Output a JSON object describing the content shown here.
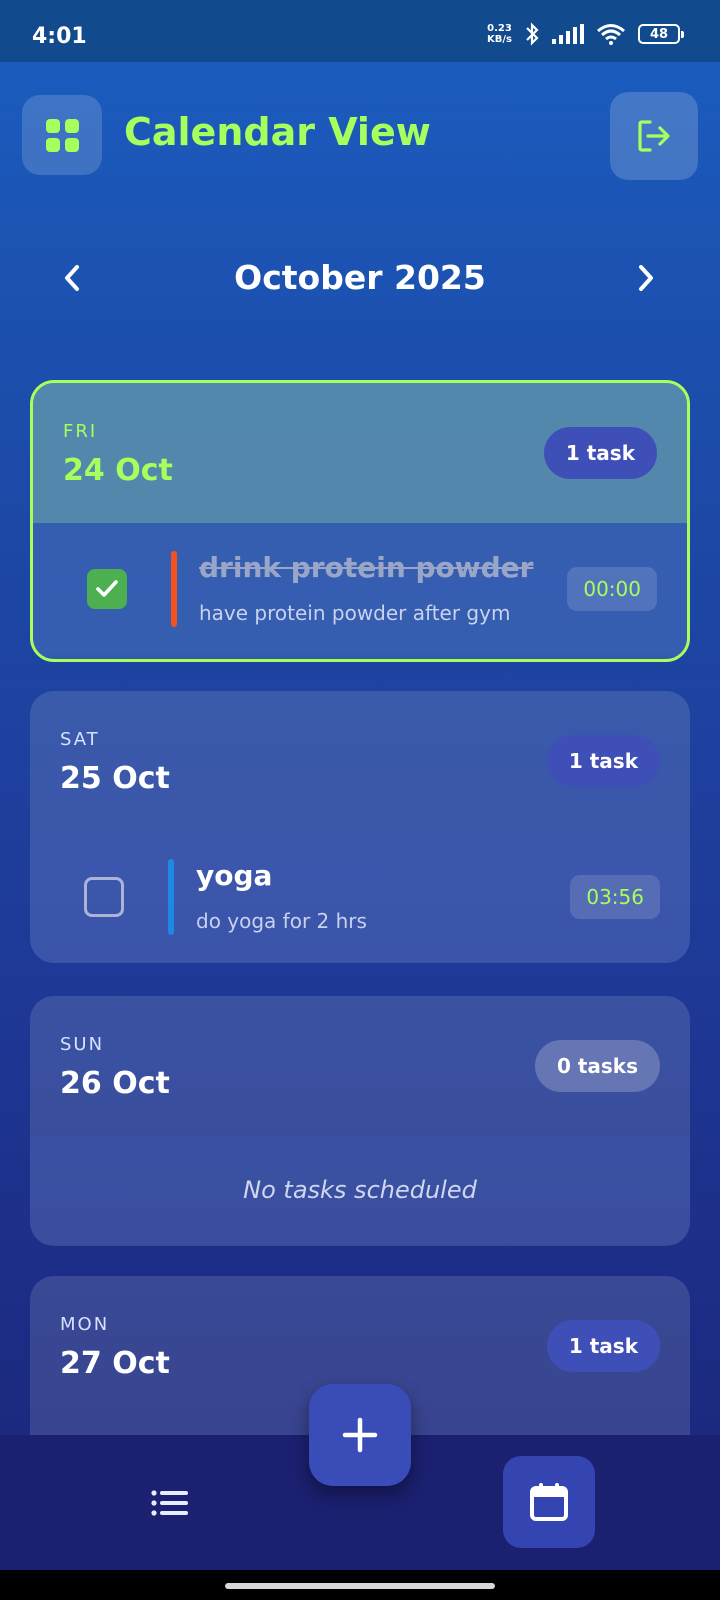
{
  "status_bar": {
    "time": "4:01",
    "net_speed_value": "0.23",
    "net_speed_unit": "KB/s",
    "battery": "48"
  },
  "header": {
    "title": "Calendar View",
    "menu_icon": "grid-icon",
    "logout_icon": "logout-icon"
  },
  "month_nav": {
    "title": "October 2025",
    "prev_icon": "chevron-left-icon",
    "next_icon": "chevron-right-icon"
  },
  "days": [
    {
      "weekday": "FRI",
      "date": "24 Oct",
      "badge": "1 task",
      "selected": true,
      "tasks": [
        {
          "title": "drink protein powder",
          "description": "have protein powder after gym",
          "time": "00:00",
          "done": true,
          "priority_color": "#f4511e"
        }
      ]
    },
    {
      "weekday": "SAT",
      "date": "25 Oct",
      "badge": "1 task",
      "selected": false,
      "tasks": [
        {
          "title": "yoga",
          "description": "do yoga for 2 hrs",
          "time": "03:56",
          "done": false,
          "priority_color": "#1e88e5"
        }
      ]
    },
    {
      "weekday": "SUN",
      "date": "26 Oct",
      "badge": "0 tasks",
      "selected": false,
      "empty_text": "No tasks scheduled"
    },
    {
      "weekday": "MON",
      "date": "27 Oct",
      "badge": "1 task",
      "selected": false
    }
  ],
  "bottom_nav": {
    "list_icon": "list-icon",
    "add_icon": "plus-icon",
    "calendar_icon": "calendar-icon"
  },
  "colors": {
    "accent": "#a6ff5c",
    "badge": "#3f4fb8",
    "checked": "#4caf50"
  }
}
